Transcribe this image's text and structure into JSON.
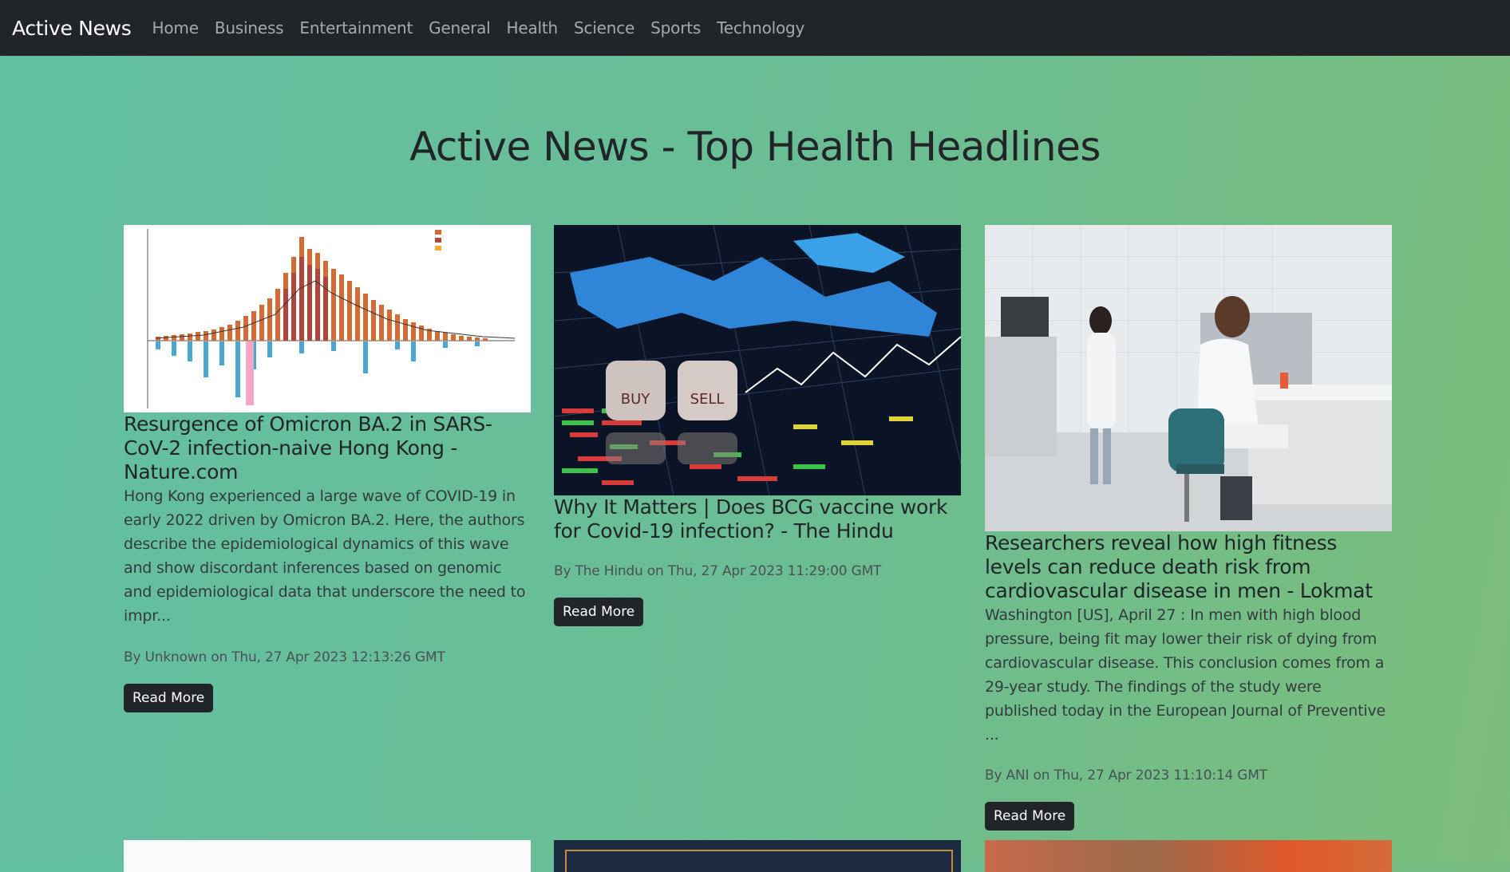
{
  "navbar": {
    "brand": "Active News",
    "links": [
      "Home",
      "Business",
      "Entertainment",
      "General",
      "Health",
      "Science",
      "Sports",
      "Technology"
    ]
  },
  "page_title": "Active News - Top Health Headlines",
  "articles": [
    {
      "image_icon": "omicron-chart-image",
      "title": "Resurgence of Omicron BA.2 in SARS-CoV-2 infection-naive Hong Kong - Nature.com",
      "description": "Hong Kong experienced a large wave of COVID-19 in early 2022 driven by Omicron BA.2. Here, the authors describe the epidemiological dynamics of this wave and show discordant inferences based on genomic and epidemiological data that underscore the need to impr...",
      "meta": "By Unknown on Thu, 27 Apr 2023 12:13:26 GMT",
      "button": "Read More"
    },
    {
      "image_icon": "stock-dice-image",
      "image_dice": [
        "BUY",
        "SELL"
      ],
      "title": "Why It Matters | Does BCG vaccine work for Covid-19 infection? - The Hindu",
      "description": "",
      "meta": "By The Hindu on Thu, 27 Apr 2023 11:29:00 GMT",
      "button": "Read More"
    },
    {
      "image_icon": "lab-researchers-image",
      "title": "Researchers reveal how high fitness levels can reduce death risk from cardiovascular disease in men - Lokmat",
      "description": "Washington [US], April 27 : In men with high blood pressure, being fit may lower their risk of dying from cardiovascular disease. This conclusion comes from a 29-year study. The findings of the study were published today in the European Journal of Preventive ...",
      "meta": "By ANI on Thu, 27 Apr 2023 11:10:14 GMT",
      "button": "Read More"
    }
  ],
  "colors": {
    "navbar": "#212529",
    "background_start": "#62c0a3",
    "background_end": "#7bbd7a",
    "button": "#212529"
  }
}
